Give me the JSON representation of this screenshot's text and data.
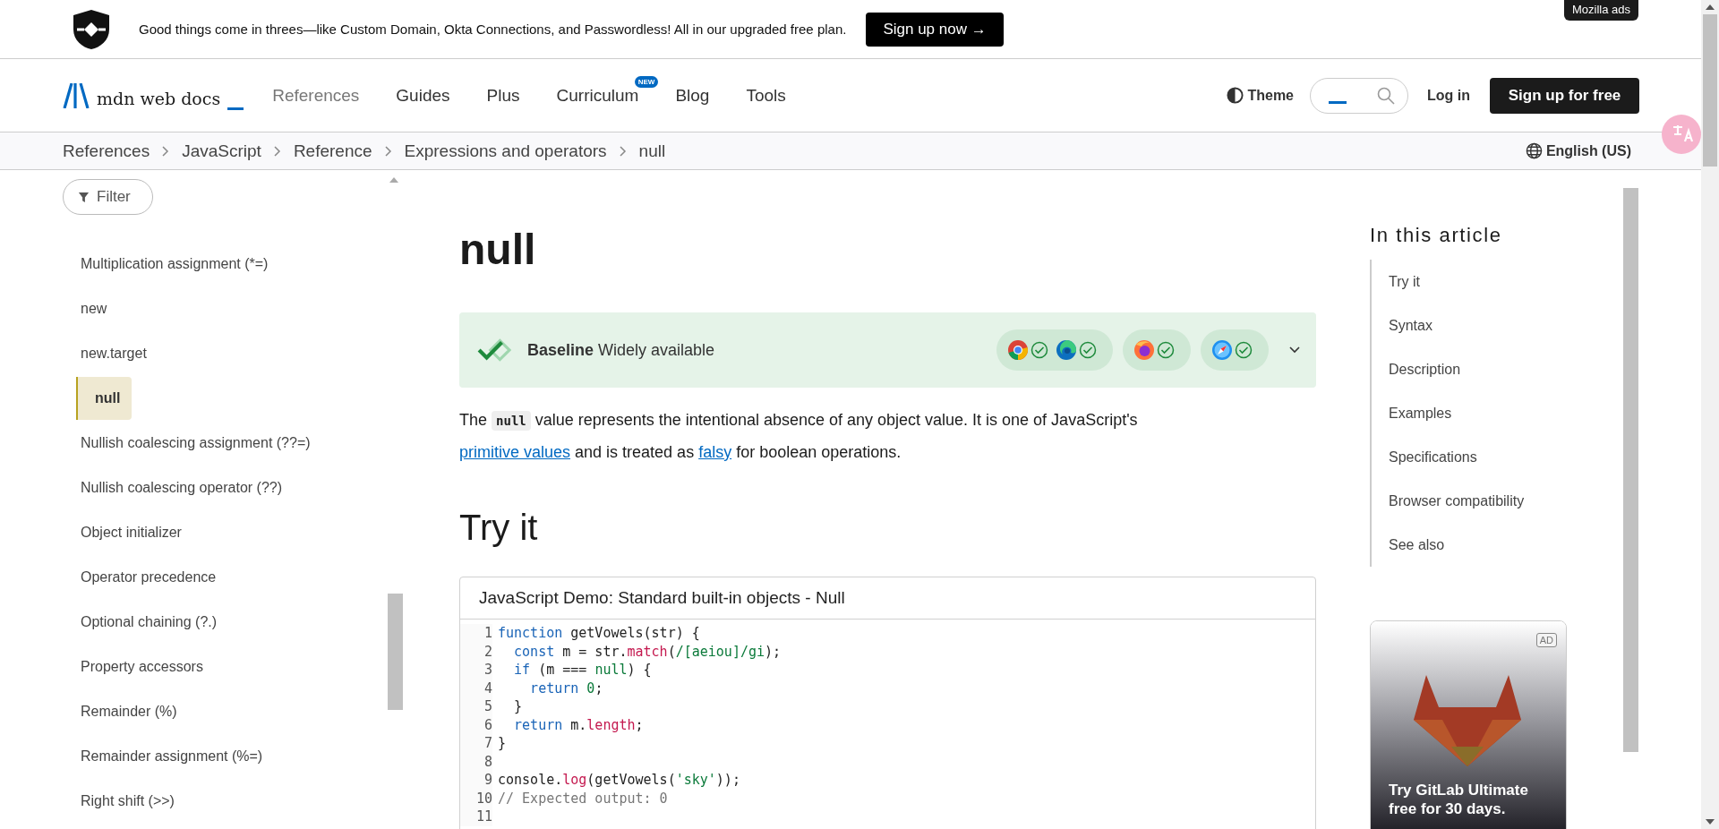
{
  "ad_banner": {
    "text": "Good things come in threes—like Custom Domain, Okta Connections, and Passwordless! All in our upgraded free plan.",
    "button": "Sign up now →",
    "tag": "Mozilla ads"
  },
  "header": {
    "logo": "mdn web docs",
    "nav": [
      {
        "label": "References",
        "selected": true
      },
      {
        "label": "Guides",
        "selected": false
      },
      {
        "label": "Plus",
        "selected": false
      },
      {
        "label": "Curriculum",
        "selected": false,
        "badge": "NEW"
      },
      {
        "label": "Blog",
        "selected": false
      },
      {
        "label": "Tools",
        "selected": false
      }
    ],
    "theme": "Theme",
    "login": "Log in",
    "signup": "Sign up for free"
  },
  "breadcrumbs": [
    "References",
    "JavaScript",
    "Reference",
    "Expressions and operators",
    "null"
  ],
  "language": "English (US)",
  "sidebar": {
    "filter": "Filter",
    "items": [
      {
        "label": "Multiplication assignment (*=)",
        "selected": false
      },
      {
        "label": "new",
        "selected": false
      },
      {
        "label": "new.target",
        "selected": false
      },
      {
        "label": "null",
        "selected": true
      },
      {
        "label": "Nullish coalescing assignment (??=)",
        "selected": false
      },
      {
        "label": "Nullish coalescing operator (??)",
        "selected": false
      },
      {
        "label": "Object initializer",
        "selected": false
      },
      {
        "label": "Operator precedence",
        "selected": false
      },
      {
        "label": "Optional chaining (?.)",
        "selected": false
      },
      {
        "label": "Property accessors",
        "selected": false
      },
      {
        "label": "Remainder (%)",
        "selected": false
      },
      {
        "label": "Remainder assignment (%=)",
        "selected": false
      },
      {
        "label": "Right shift (>>)",
        "selected": false
      }
    ]
  },
  "article": {
    "title": "null",
    "baseline": {
      "text": "**Baseline** Widely available",
      "pills": [
        {
          "browsers": [
            {
              "kind": "chrome",
              "supported": true
            },
            {
              "kind": "edge",
              "supported": true
            }
          ]
        },
        {
          "browsers": [
            {
              "kind": "firefox",
              "supported": true
            }
          ]
        },
        {
          "browsers": [
            {
              "kind": "safari",
              "supported": true
            }
          ]
        }
      ]
    },
    "intro": [
      {
        "kind": "text",
        "text": "The "
      },
      {
        "kind": "code",
        "text": "null"
      },
      {
        "kind": "text",
        "text": " value represents the intentional absence of any object value. It is one of JavaScript's "
      },
      {
        "kind": "link",
        "text": "primitive values"
      },
      {
        "kind": "text",
        "text": " and is treated as "
      },
      {
        "kind": "link",
        "text": "falsy"
      },
      {
        "kind": "text",
        "text": " for boolean operations."
      }
    ],
    "section_title": "Try it",
    "demo": {
      "title": "JavaScript Demo: Standard built-in objects - Null",
      "lines": [
        {
          "number": "1",
          "tokens": [
            {
              "kind": "keyword",
              "text": "function"
            },
            {
              "kind": "plain",
              "text": " getVowels(str) {"
            }
          ]
        },
        {
          "number": "2",
          "tokens": [
            {
              "kind": "keyword",
              "text": "  const"
            },
            {
              "kind": "plain",
              "text": " m = str."
            },
            {
              "kind": "property",
              "text": "match"
            },
            {
              "kind": "plain",
              "text": "("
            },
            {
              "kind": "literal",
              "text": "/[aeiou]/gi"
            },
            {
              "kind": "plain",
              "text": ");"
            }
          ]
        },
        {
          "number": "3",
          "tokens": [
            {
              "kind": "keyword",
              "text": "  if"
            },
            {
              "kind": "plain",
              "text": " (m === "
            },
            {
              "kind": "literal",
              "text": "null"
            },
            {
              "kind": "plain",
              "text": ") {"
            }
          ]
        },
        {
          "number": "4",
          "tokens": [
            {
              "kind": "keyword",
              "text": "    return"
            },
            {
              "kind": "literal",
              "text": " 0"
            },
            {
              "kind": "plain",
              "text": ";"
            }
          ]
        },
        {
          "number": "5",
          "tokens": [
            {
              "kind": "plain",
              "text": "  }"
            }
          ]
        },
        {
          "number": "6",
          "tokens": [
            {
              "kind": "keyword",
              "text": "  return"
            },
            {
              "kind": "plain",
              "text": " m."
            },
            {
              "kind": "property",
              "text": "length"
            },
            {
              "kind": "plain",
              "text": ";"
            }
          ]
        },
        {
          "number": "7",
          "tokens": [
            {
              "kind": "plain",
              "text": "}"
            }
          ]
        },
        {
          "number": "8"
        },
        {
          "number": "9",
          "tokens": [
            {
              "kind": "plain",
              "text": "console."
            },
            {
              "kind": "property",
              "text": "log"
            },
            {
              "kind": "plain",
              "text": "(getVowels("
            },
            {
              "kind": "literal",
              "text": "'sky'"
            },
            {
              "kind": "plain",
              "text": "));"
            }
          ]
        },
        {
          "number": "10",
          "tokens": [
            {
              "kind": "comment",
              "text": "// Expected output: 0"
            }
          ]
        },
        {
          "number": "11"
        }
      ]
    }
  },
  "toc": {
    "title": "In this article",
    "items": [
      "Try it",
      "Syntax",
      "Description",
      "Examples",
      "Specifications",
      "Browser compatibility",
      "See also"
    ]
  },
  "ad": {
    "kind": "picture",
    "tag": "AD",
    "text": "Try GitLab Ultimate free for 30 days."
  }
}
